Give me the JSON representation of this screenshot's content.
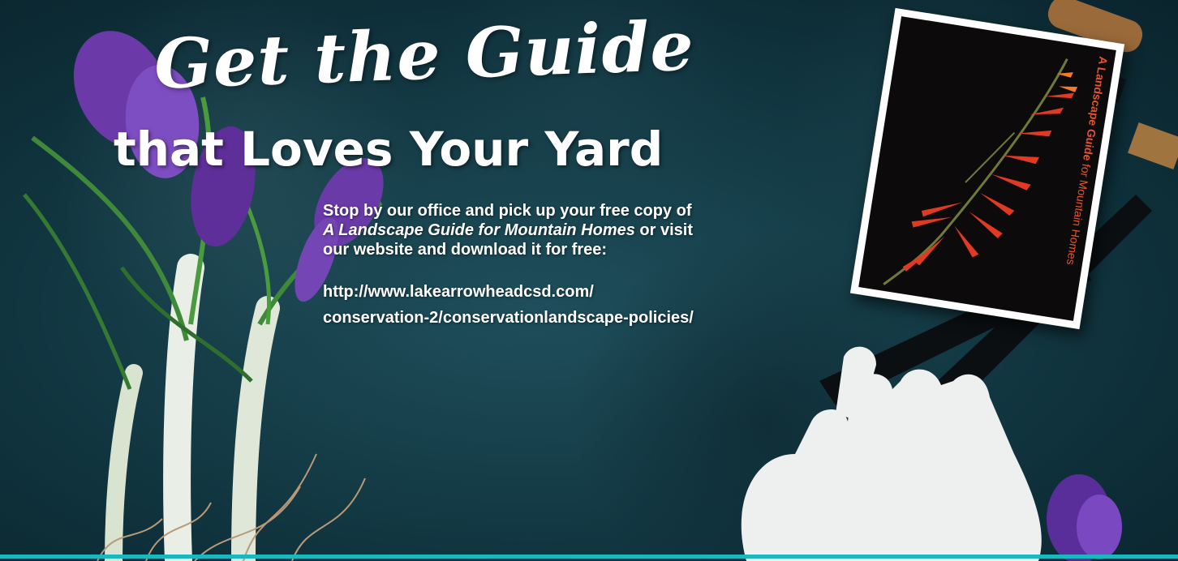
{
  "headline": {
    "script": "Get the Guide",
    "main": "that Loves Your Yard"
  },
  "body": {
    "line1": "Stop by our office and pick up your free copy of",
    "book_title": "A Landscape Guide for Mountain Homes",
    "line2_rest": " or visit",
    "line3": "our website and download it for free:"
  },
  "url": {
    "line1": "http://www.lakearrowheadcsd.com/",
    "line2": "conservation-2/conservationlandscape-policies/"
  },
  "book_cover": {
    "title_bold": "A Landscape Guide",
    "title_light": " for Mountain Homes"
  },
  "colors": {
    "background": "#163f4a",
    "accent_rule": "#19b7c0",
    "cover_text": "#e8542a",
    "flower_red": "#e03a22",
    "crocus_purple": "#6a3aa8"
  }
}
